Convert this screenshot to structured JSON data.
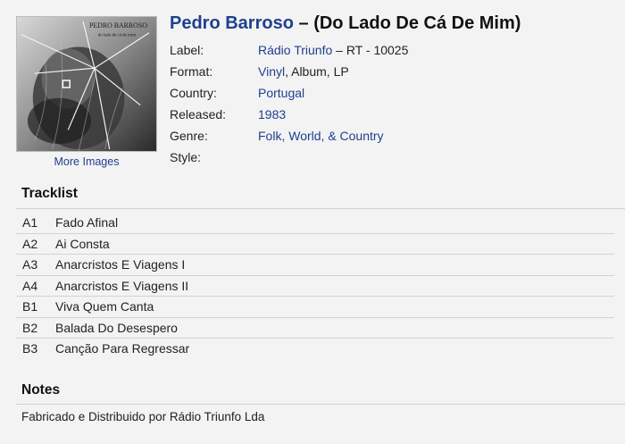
{
  "cover": {
    "text_line1": "PEDRO BARROSO",
    "text_line2": "do lado de cá de mim",
    "more_images": "More Images"
  },
  "release": {
    "artist": "Pedro Barroso",
    "separator": " – ",
    "title": "(Do Lado De Cá De Mim)"
  },
  "meta": {
    "label": {
      "key": "Label:",
      "link": "Rádio Triunfo",
      "rest": " – RT - 10025"
    },
    "format": {
      "key": "Format:",
      "link": "Vinyl",
      "rest": ", Album, LP"
    },
    "country": {
      "key": "Country:",
      "value": "Portugal"
    },
    "released": {
      "key": "Released:",
      "value": "1983"
    },
    "genre": {
      "key": "Genre:",
      "value": "Folk, World, & Country"
    },
    "style": {
      "key": "Style:",
      "value": ""
    }
  },
  "tracklist": {
    "heading": "Tracklist",
    "tracks": [
      {
        "position": "A1",
        "title": "Fado Afinal"
      },
      {
        "position": "A2",
        "title": "Ai Consta"
      },
      {
        "position": "A3",
        "title": "Anarcristos E Viagens I"
      },
      {
        "position": "A4",
        "title": "Anarcristos E Viagens II"
      },
      {
        "position": "B1",
        "title": "Viva Quem Canta"
      },
      {
        "position": "B2",
        "title": "Balada Do Desespero"
      },
      {
        "position": "B3",
        "title": "Canção Para Regressar"
      }
    ]
  },
  "notes": {
    "heading": "Notes",
    "text": "Fabricado e Distribuido por Rádio Triunfo Lda"
  },
  "colors": {
    "link": "#1f3f8f",
    "background": "#f3f3f3",
    "rule": "#d3d3d3"
  }
}
